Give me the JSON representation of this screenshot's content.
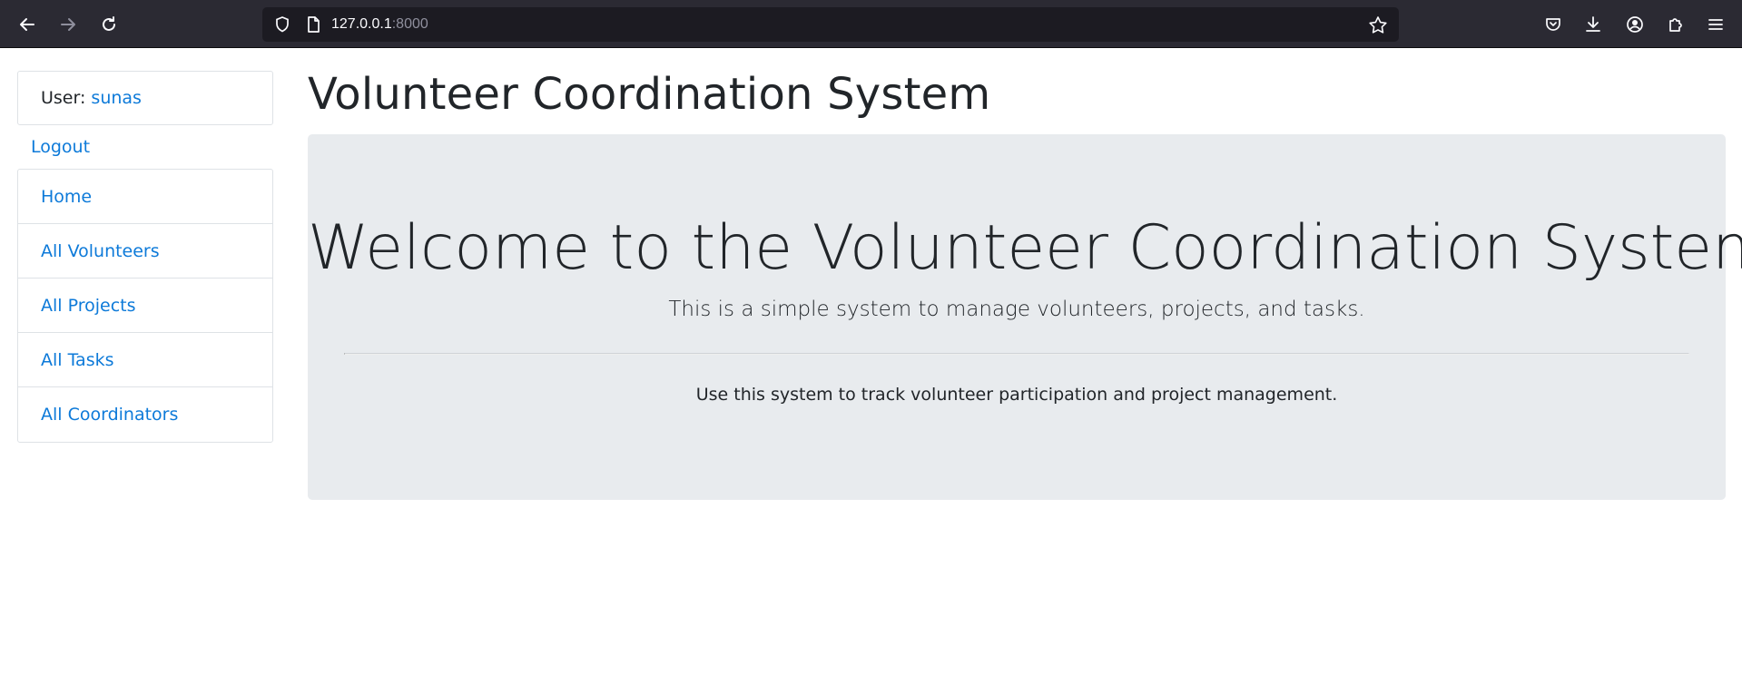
{
  "browser": {
    "url_host": "127.0.0.1",
    "url_port": ":8000"
  },
  "sidebar": {
    "user_label": "User: ",
    "username": "sunas",
    "logout": "Logout",
    "nav": [
      {
        "label": "Home"
      },
      {
        "label": "All Volunteers"
      },
      {
        "label": "All Projects"
      },
      {
        "label": "All Tasks"
      },
      {
        "label": "All Coordinators"
      }
    ]
  },
  "main": {
    "title": "Volunteer Coordination System",
    "jumbotron": {
      "heading": "Welcome to the Volunteer Coordination System",
      "lead": "This is a simple system to manage volunteers, projects, and tasks.",
      "text": "Use this system to track volunteer participation and project management."
    }
  },
  "colors": {
    "link": "#0d7ad9",
    "jumbotron_bg": "#e8ebee",
    "toolbar_bg": "#2b2a33"
  }
}
